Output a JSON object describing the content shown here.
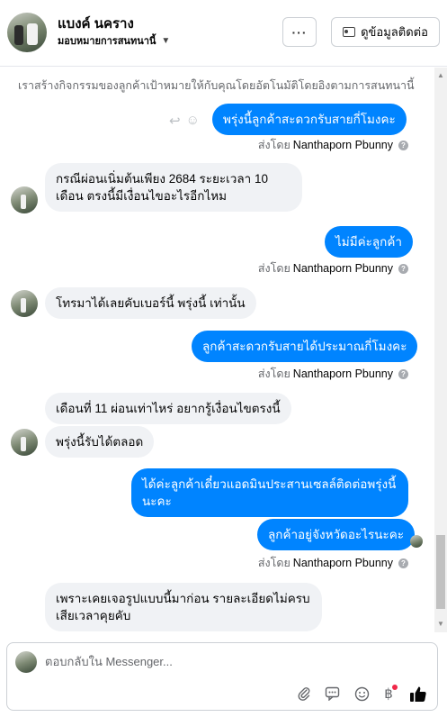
{
  "header": {
    "page_name": "แบงค์ นคราง",
    "assignment": "มอบหมายการสนทนานี้",
    "more_label": "···",
    "contact_label": "ดูข้อมูลติดต่อ"
  },
  "chat": {
    "system_note": "เราสร้างกิจกรรมของลูกค้าเป้าหมายให้กับคุณโดยอัตโนมัติโดยอิงตามการสนทนานี้",
    "sent_by_prefix": "ส่งโดย",
    "sent_by_agent": "Nanthaporn Pbunny",
    "messages": [
      {
        "text": "พรุ่งนี้ลูกค้าสะดวกรับสายกี่โมงคะ"
      },
      {
        "text": "กรณีผ่อนเนิ่มต้นเพียง 2684 ระยะเวลา 10 เดือน ตรงนี้มีเงื่อนไขอะไรอีกไหม"
      },
      {
        "text": "ไม่มีค่ะลูกค้า"
      },
      {
        "text": "โทรมาได้เลยคับเบอร์นี้ พรุ่งนี้ เท่านั้น"
      },
      {
        "text": "ลูกค้าสะดวกรับสายได้ประมาณกี่โมงคะ"
      },
      {
        "text": "เดือนที่ 11 ผ่อนเท่าไหร่ อยากรู้เงื่อนไขตรงนี้"
      },
      {
        "text": "พรุ่งนี้รับได้ตลอด"
      },
      {
        "text": "ได้ค่ะลูกค้าเดี๋ยวแอดมินประสานเซลล์ติดต่อพรุ่งนี้นะคะ"
      },
      {
        "text": "ลูกค้าอยู่จังหวัดอะไรนะคะ"
      },
      {
        "text": "เพราะเคยเจอรูปแบบนี้มาก่อน รายละเอียดไม่ครบ เสียเวลาคุยคับ"
      }
    ]
  },
  "composer": {
    "placeholder": "ตอบกลับใน Messenger..."
  },
  "icons": {
    "more": "more-dots-icon",
    "contact": "id-card-icon",
    "info": "info-icon",
    "attach": "paperclip-icon",
    "saved_replies": "speech-bubble-icon",
    "emoji": "emoji-icon",
    "payment": "baht-icon",
    "like": "thumbs-up-icon"
  },
  "colors": {
    "outgoing_bubble": "#0084ff",
    "incoming_bubble": "#f0f2f5",
    "like_button": "#050505",
    "notification_dot": "#f02849"
  }
}
